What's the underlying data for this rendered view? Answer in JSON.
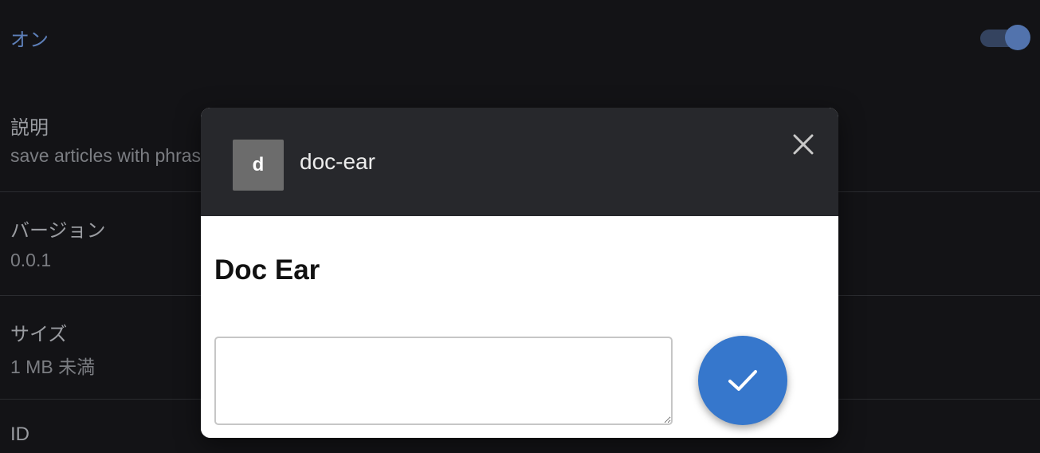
{
  "settings": {
    "enabled_label": "オン",
    "enabled": true,
    "description_label": "説明",
    "description_value": "save articles with phrases",
    "version_label": "バージョン",
    "version_value": "0.0.1",
    "size_label": "サイズ",
    "size_value": "1 MB 未満",
    "id_label": "ID"
  },
  "dialog": {
    "app_icon_letter": "d",
    "app_name": "doc-ear",
    "title": "Doc Ear",
    "input_value": "",
    "input_placeholder": "",
    "close_icon": "close-icon",
    "confirm_icon": "check-icon"
  },
  "colors": {
    "background": "#131316",
    "accent": "#3677cc",
    "toggle_knob": "#5273ad",
    "header_bg": "#27282c"
  }
}
